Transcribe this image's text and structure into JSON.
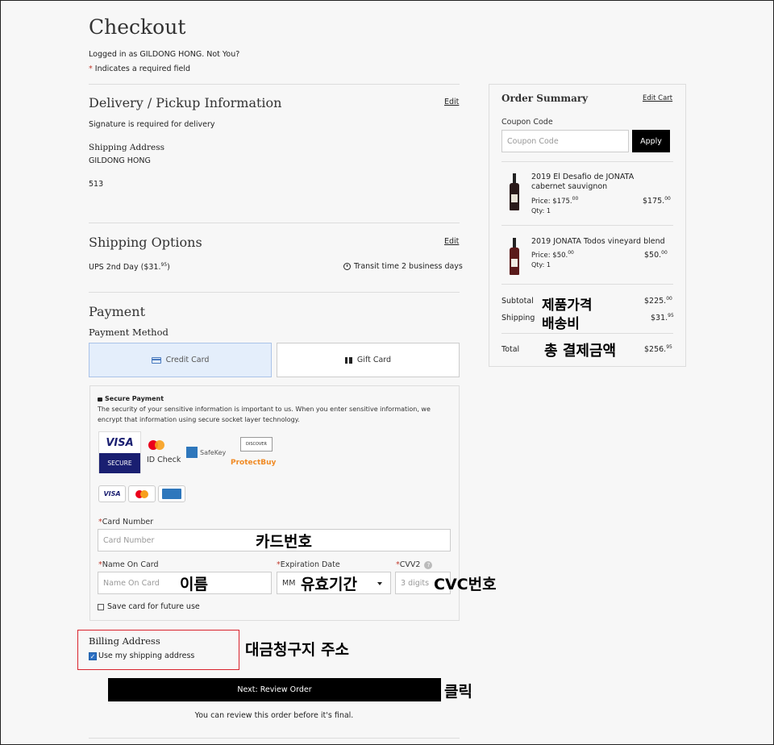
{
  "page": {
    "title": "Checkout",
    "logged_in": "Logged in as GILDONG HONG. Not You?",
    "required_note": "Indicates a required field",
    "required_star": "*"
  },
  "delivery": {
    "heading": "Delivery / Pickup Information",
    "edit": "Edit",
    "signature": "Signature is required for delivery",
    "address_label": "Shipping Address",
    "name": "GILDONG HONG",
    "line2": "513"
  },
  "shipping": {
    "heading": "Shipping Options",
    "edit": "Edit",
    "method": "UPS 2nd Day ($31.",
    "method_cents": "95",
    "method_end": ")",
    "transit": "Transit time 2 business days"
  },
  "payment": {
    "heading": "Payment",
    "method_heading": "Payment Method",
    "credit_card": "Credit Card",
    "gift_card": "Gift Card",
    "secure_title": "Secure Payment",
    "secure_text": "The security of your sensitive information is important to us. When you enter sensitive information, we encrypt that information using secure socket layer technology.",
    "badges": {
      "visa": "VISA",
      "secure": "SECURE",
      "id_check": "ID Check",
      "safekey": "SafeKey",
      "discover": "DISCOVER",
      "protectbuy": "ProtectBuy",
      "visa_small": "VISA"
    },
    "card_number_label": "Card Number",
    "card_number_placeholder": "Card Number",
    "name_label": "Name On Card",
    "name_placeholder": "Name On Card",
    "exp_label": "Expiration Date",
    "exp_value": "MM",
    "cvv_label": "CVV2",
    "cvv_placeholder": "3 digits",
    "save_card": "Save card for future use"
  },
  "billing": {
    "heading": "Billing Address",
    "use_shipping": "Use my shipping address"
  },
  "actions": {
    "next": "Next: Review Order",
    "note": "You can review this order before it's final."
  },
  "summary": {
    "heading": "Order Summary",
    "edit_cart": "Edit Cart",
    "coupon_label": "Coupon Code",
    "coupon_placeholder": "Coupon Code",
    "apply": "Apply",
    "items": [
      {
        "name": "2019 El Desafio de JONATA cabernet sauvignon",
        "price_label": "Price: $175.",
        "price_cents": "00",
        "qty": "Qty: 1",
        "total": "$175.",
        "total_cents": "00"
      },
      {
        "name": "2019 JONATA Todos vineyard blend",
        "price_label": "Price: $50.",
        "price_cents": "00",
        "qty": "Qty: 1",
        "total": "$50.",
        "total_cents": "00"
      }
    ],
    "subtotal_label": "Subtotal",
    "subtotal": "$225.",
    "subtotal_cents": "00",
    "shipping_label": "Shipping",
    "shipping": "$31.",
    "shipping_cents": "95",
    "total_label": "Total",
    "total": "$256.",
    "total_cents": "95"
  },
  "annotations": {
    "product_price": "제품가격",
    "shipping_fee": "배송비",
    "total_payment": "총 결제금액",
    "card_number": "카드번호",
    "name": "이름",
    "expiry": "유효기간",
    "cvc": "CVC번호",
    "billing_address": "대금청구지 주소",
    "click": "클릭"
  },
  "colors": {
    "highlight_box": "#d9232d",
    "active_tab_bg": "#e4eefb",
    "primary_button": "#000000"
  }
}
